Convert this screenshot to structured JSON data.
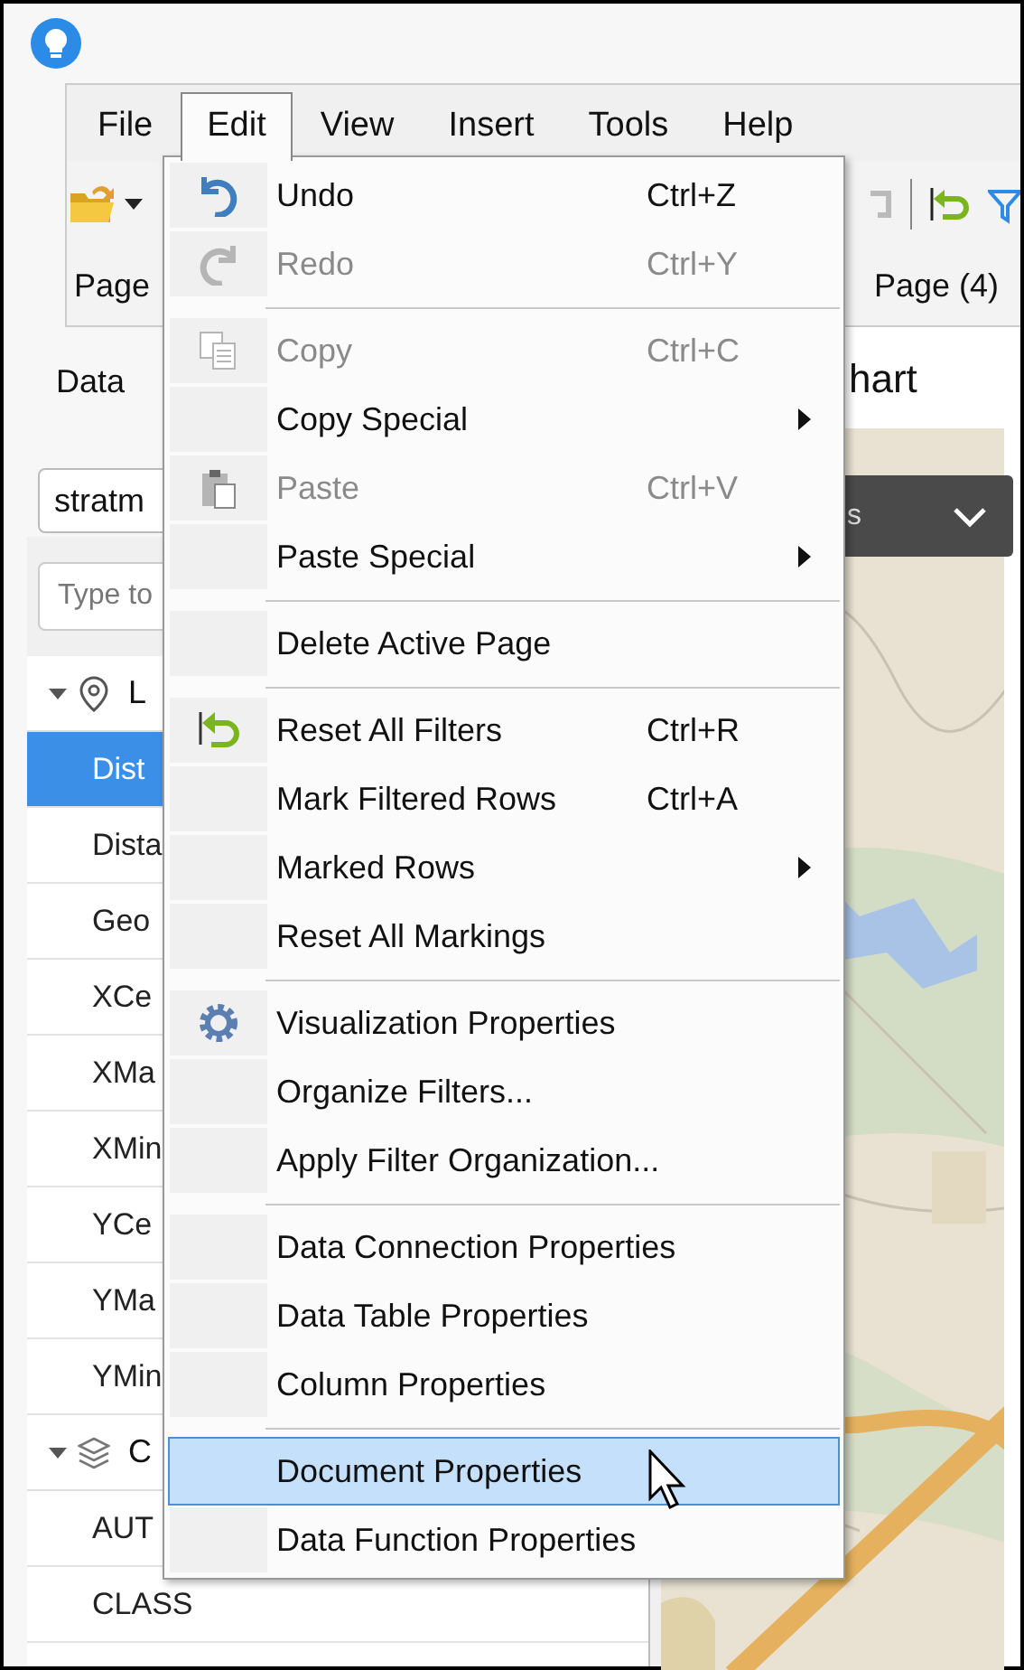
{
  "menu_bar": [
    {
      "label": "File",
      "selected": false
    },
    {
      "label": "Edit",
      "selected": true
    },
    {
      "label": "View",
      "selected": false
    },
    {
      "label": "Insert",
      "selected": false
    },
    {
      "label": "Tools",
      "selected": false
    },
    {
      "label": "Help",
      "selected": false
    }
  ],
  "tabs": [
    {
      "label": "Page",
      "selected": false
    },
    {
      "label": "Page (4)",
      "selected": false
    }
  ],
  "data_panel": {
    "title": "Data",
    "dropdown": {
      "value": "stratm"
    },
    "search": {
      "placeholder": "Type to"
    },
    "groups": [
      {
        "label": "L",
        "expanded": true,
        "items": [
          {
            "label": "Dist",
            "selected": true
          },
          {
            "label": "Dista",
            "selected": false
          },
          {
            "label": "Geo",
            "selected": false
          },
          {
            "label": "XCe",
            "selected": false
          },
          {
            "label": "XMa",
            "selected": false
          },
          {
            "label": "XMin",
            "selected": false
          },
          {
            "label": "YCe",
            "selected": false
          },
          {
            "label": "YMa",
            "selected": false
          },
          {
            "label": "YMin",
            "selected": false
          }
        ]
      },
      {
        "label": "C",
        "expanded": true,
        "items": [
          {
            "label": "AUT",
            "selected": false
          },
          {
            "label": "CLASS",
            "selected": false
          }
        ]
      }
    ]
  },
  "visualization": {
    "title": "hart",
    "legend": {
      "label": "s",
      "expanded": false
    }
  },
  "edit_menu": {
    "groups": [
      [
        {
          "label": "Undo",
          "shortcut": "Ctrl+Z",
          "disabled": false,
          "selected": false,
          "submenu": false
        },
        {
          "label": "Redo",
          "shortcut": "Ctrl+Y",
          "disabled": true,
          "selected": false,
          "submenu": false
        }
      ],
      [
        {
          "label": "Copy",
          "shortcut": "Ctrl+C",
          "disabled": true,
          "selected": false,
          "submenu": false
        },
        {
          "label": "Copy Special",
          "disabled": false,
          "selected": false,
          "submenu": true
        },
        {
          "label": "Paste",
          "shortcut": "Ctrl+V",
          "disabled": true,
          "selected": false,
          "submenu": false
        },
        {
          "label": "Paste Special",
          "disabled": false,
          "selected": false,
          "submenu": true
        }
      ],
      [
        {
          "label": "Delete Active Page",
          "disabled": false,
          "selected": false,
          "submenu": false
        }
      ],
      [
        {
          "label": "Reset All Filters",
          "shortcut": "Ctrl+R",
          "disabled": false,
          "selected": false,
          "submenu": false
        },
        {
          "label": "Mark Filtered Rows",
          "shortcut": "Ctrl+A",
          "disabled": false,
          "selected": false,
          "submenu": false
        },
        {
          "label": "Marked Rows",
          "disabled": false,
          "selected": false,
          "submenu": true
        },
        {
          "label": "Reset All Markings",
          "disabled": false,
          "selected": false,
          "submenu": false
        }
      ],
      [
        {
          "label": "Visualization Properties",
          "disabled": false,
          "selected": false,
          "submenu": false
        },
        {
          "label": "Organize Filters...",
          "disabled": false,
          "selected": false,
          "submenu": false
        },
        {
          "label": "Apply Filter Organization...",
          "disabled": false,
          "selected": false,
          "submenu": false
        }
      ],
      [
        {
          "label": "Data Connection Properties",
          "disabled": false,
          "selected": false,
          "submenu": false
        },
        {
          "label": "Data Table Properties",
          "disabled": false,
          "selected": false,
          "submenu": false
        },
        {
          "label": "Column Properties",
          "disabled": false,
          "selected": false,
          "submenu": false
        }
      ],
      [
        {
          "label": "Document Properties",
          "disabled": false,
          "selected": true,
          "submenu": false
        },
        {
          "label": "Data Function Properties",
          "disabled": false,
          "selected": false,
          "submenu": false
        }
      ]
    ]
  }
}
